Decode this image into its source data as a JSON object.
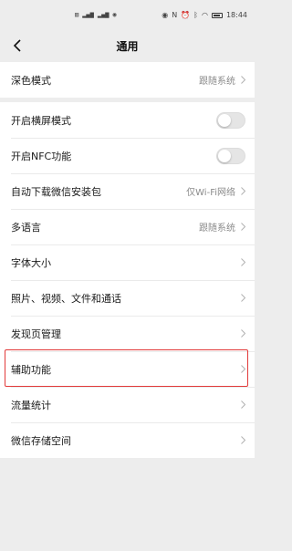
{
  "status_bar": {
    "left_icons": "",
    "time": "18:44"
  },
  "nav": {
    "title": "通用"
  },
  "group1": [
    {
      "label": "深色模式",
      "value": "跟随系统",
      "type": "link"
    }
  ],
  "group2": [
    {
      "label": "开启横屏模式",
      "type": "toggle"
    },
    {
      "label": "开启NFC功能",
      "type": "toggle"
    },
    {
      "label": "自动下载微信安装包",
      "value": "仅Wi-Fi网络",
      "type": "link"
    },
    {
      "label": "多语言",
      "value": "跟随系统",
      "type": "link"
    },
    {
      "label": "字体大小",
      "type": "link"
    },
    {
      "label": "照片、视频、文件和通话",
      "type": "link"
    },
    {
      "label": "发现页管理",
      "type": "link"
    },
    {
      "label": "辅助功能",
      "type": "link"
    },
    {
      "label": "流量统计",
      "type": "link"
    },
    {
      "label": "微信存储空间",
      "type": "link"
    }
  ],
  "colors": {
    "highlight": "#e23a3a",
    "background": "#ededed"
  }
}
